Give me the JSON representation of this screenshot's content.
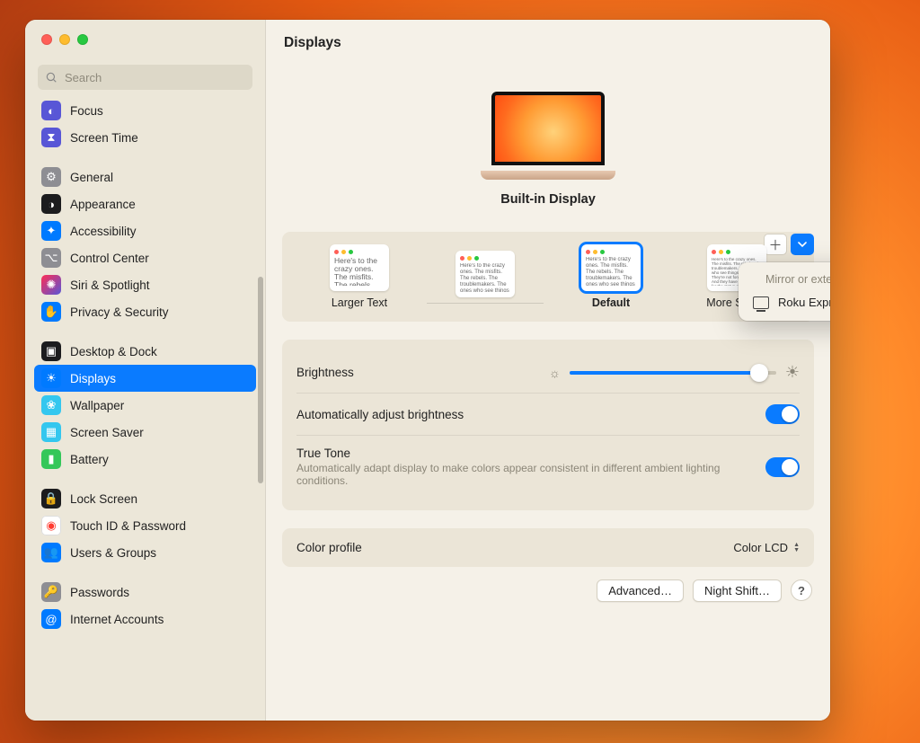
{
  "header": {
    "title": "Displays"
  },
  "search": {
    "placeholder": "Search",
    "value": ""
  },
  "sidebar": {
    "groups": [
      {
        "items": [
          {
            "label": "Focus",
            "icon": "focus"
          },
          {
            "label": "Screen Time",
            "icon": "screentime"
          }
        ]
      },
      {
        "items": [
          {
            "label": "General",
            "icon": "general"
          },
          {
            "label": "Appearance",
            "icon": "appearance"
          },
          {
            "label": "Accessibility",
            "icon": "accessibility"
          },
          {
            "label": "Control Center",
            "icon": "controlcenter"
          },
          {
            "label": "Siri & Spotlight",
            "icon": "siri"
          },
          {
            "label": "Privacy & Security",
            "icon": "privacy"
          }
        ]
      },
      {
        "items": [
          {
            "label": "Desktop & Dock",
            "icon": "desktop"
          },
          {
            "label": "Displays",
            "icon": "displays",
            "selected": true
          },
          {
            "label": "Wallpaper",
            "icon": "wallpaper"
          },
          {
            "label": "Screen Saver",
            "icon": "screensaver"
          },
          {
            "label": "Battery",
            "icon": "battery"
          }
        ]
      },
      {
        "items": [
          {
            "label": "Lock Screen",
            "icon": "lockscreen"
          },
          {
            "label": "Touch ID & Password",
            "icon": "touchid"
          },
          {
            "label": "Users & Groups",
            "icon": "users"
          }
        ]
      },
      {
        "items": [
          {
            "label": "Passwords",
            "icon": "passwords"
          },
          {
            "label": "Internet Accounts",
            "icon": "internet"
          }
        ]
      }
    ]
  },
  "device": {
    "name": "Built-in Display"
  },
  "popover": {
    "title": "Mirror or extend to",
    "item": "Roku Express"
  },
  "resolutions": {
    "sample_text": "Here's to the crazy ones. The misfits. The rebels. The troublemakers. The ones who see things differently. They're not fond of rules. And they have no respect for the status quo. You can quote them, disagree with them, glorify or vilify them. About the only thing you can't do is ignore them. Because they change things.",
    "options": [
      {
        "label": "Larger Text"
      },
      {
        "label": ""
      },
      {
        "label": "Default",
        "selected": true
      },
      {
        "label": "More Space"
      }
    ]
  },
  "settings": {
    "brightness_label": "Brightness",
    "brightness_percent": 92,
    "auto_brightness_label": "Automatically adjust brightness",
    "auto_brightness_on": true,
    "truetone_label": "True Tone",
    "truetone_desc": "Automatically adapt display to make colors appear consistent in different ambient lighting conditions.",
    "truetone_on": true,
    "color_profile_label": "Color profile",
    "color_profile_value": "Color LCD"
  },
  "buttons": {
    "advanced": "Advanced…",
    "night_shift": "Night Shift…"
  }
}
